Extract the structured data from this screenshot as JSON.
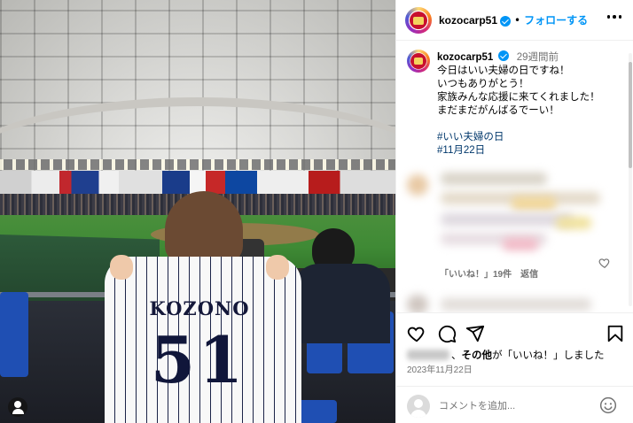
{
  "header": {
    "username": "kozocarp51",
    "separator": "•",
    "follow_label": "フォローする"
  },
  "caption": {
    "username": "kozocarp51",
    "time": "29週間前",
    "text": "今日はいい夫婦の日ですね！\nいつもありがとう！\n家族みんな応援に来てくれました！\nまだまだがんばるでーい！",
    "hashtags": [
      "#いい夫婦の日",
      "#11月22日"
    ]
  },
  "comment": {
    "likes": "「いいね！」19件",
    "reply_label": "返信"
  },
  "photo": {
    "jersey_name": "KOZONO",
    "jersey_number": "51"
  },
  "likes_line": {
    "suffix": "、",
    "others": "その他",
    "rest": "が「いいね！」しました"
  },
  "date": "2023年11月22日",
  "comment_box": {
    "placeholder": "コメントを追加..."
  },
  "colors": {
    "follow_blue": "#0095f6",
    "verified_blue": "#0095f6",
    "hashtag": "#00376b",
    "muted": "#737373"
  },
  "icons": [
    "heart-icon",
    "comment-icon",
    "share-icon",
    "bookmark-icon",
    "emoji-icon",
    "more-icon",
    "user-tag-icon"
  ]
}
